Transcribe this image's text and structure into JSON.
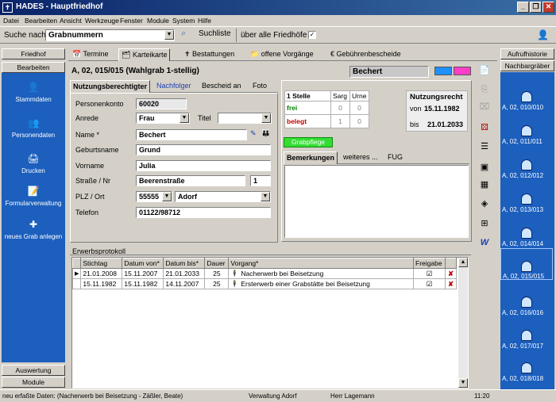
{
  "window": {
    "title": "HADES - Hauptfriedhof",
    "controls": [
      "_",
      "❐",
      "✕"
    ]
  },
  "menu": [
    "Datei",
    "Bearbeiten",
    "Ansicht",
    "Werkzeuge",
    "Fenster",
    "Module",
    "System",
    "Hilfe"
  ],
  "toolbar": {
    "search_label": "Suche nach",
    "search_value": "Grabnummern",
    "list_button": "Suchliste",
    "all_cemeteries": "über alle Friedhöfe",
    "all_cemeteries_checked": true
  },
  "left_sidebar": {
    "top_header": "Friedhof",
    "section_header": "Bearbeiten",
    "items": [
      {
        "label": "Stammdaten",
        "icon": "person-icon"
      },
      {
        "label": "Personendaten",
        "icon": "people-icon"
      },
      {
        "label": "Drucken",
        "icon": "printer-icon"
      },
      {
        "label": "Formularverwaltung",
        "icon": "form-icon"
      },
      {
        "label": "neues Grab anlegen",
        "icon": "new-grave-icon"
      }
    ],
    "bottom_headers": [
      "Auswertung",
      "Module"
    ]
  },
  "main_tabs": [
    "Termine",
    "Karteikarte",
    "Bestattungen",
    "offene Vorgänge",
    "Gebührenbescheide"
  ],
  "grave": {
    "title": "A, 02, 015/015 (Wahlgrab 1-stellig)",
    "owner_name": "Bechert",
    "colors": [
      "#1e90ff",
      "#ff3ec8"
    ]
  },
  "subtabs": [
    "Nutzungsberechtigter",
    "Nachfolger",
    "Bescheid an",
    "Foto"
  ],
  "form": {
    "personenkonto_label": "Personenkonto",
    "personenkonto": "60020",
    "anrede_label": "Anrede",
    "anrede": "Frau",
    "titel_label": "Titel",
    "titel": "",
    "name_label": "Name *",
    "name": "Bechert",
    "geburtsname_label": "Geburtsname",
    "geburtsname": "Grund",
    "vorname_label": "Vorname",
    "vorname": "Julia",
    "strasse_label": "Straße / Nr",
    "strasse": "Beerenstraße",
    "hausnr": "1",
    "plz_label": "PLZ / Ort",
    "plz": "55555",
    "ort": "Adorf",
    "telefon_label": "Telefon",
    "telefon": "01122/98712"
  },
  "stellen": {
    "header": [
      "1 Stelle",
      "Sarg",
      "Urne"
    ],
    "rows": [
      {
        "label": "frei",
        "color": "#008000",
        "sarg": "0",
        "urne": "0"
      },
      {
        "label": "belegt",
        "color": "#c00000",
        "sarg": "1",
        "urne": "0"
      }
    ]
  },
  "nutzungsrecht": {
    "title": "Nutzungsrecht",
    "von_label": "von",
    "von": "15.11.1982",
    "bis_label": "bis",
    "bis": "21.01.2033"
  },
  "grabpflege_button": "Grabpflege",
  "note_tabs": [
    "Bemerkungen",
    "weiteres ...",
    "FUG"
  ],
  "erwerbsprotokoll": {
    "title": "Erwerbsprotokoll",
    "columns": [
      "Stichtag",
      "Datum von*",
      "Datum bis*",
      "Dauer",
      "Vorgang*",
      "Freigabe",
      ""
    ],
    "rows": [
      {
        "stichtag": "21.01.2008",
        "von": "15.11.2007",
        "bis": "21.01.2033",
        "dauer": "25",
        "vorgang": "Nacherwerb bei Beisetzung",
        "freigabe": true
      },
      {
        "stichtag": "15.11.1982",
        "von": "15.11.1982",
        "bis": "14.11.2007",
        "dauer": "25",
        "vorgang": "Ersterwerb einer Grabstätte bei Beisetzung",
        "freigabe": true
      }
    ]
  },
  "right_sidebar": {
    "top_header": "Aufrufhistorie",
    "section_header": "Nachbargräber",
    "graves": [
      "A, 02, 010/010",
      "A, 02, 011/011",
      "A, 02, 012/012",
      "A, 02, 013/013",
      "A, 02, 014/014",
      "A, 02, 015/015",
      "A, 02, 016/016",
      "A, 02, 017/017",
      "A, 02, 018/018"
    ]
  },
  "statusbar": {
    "message": "neu erfaßte Daten: (Nacherwerb bei Beisetzung - Zäßler, Beate)",
    "admin": "Verwaltung Adorf",
    "user": "Herr Lagemann",
    "time": "11:20"
  }
}
